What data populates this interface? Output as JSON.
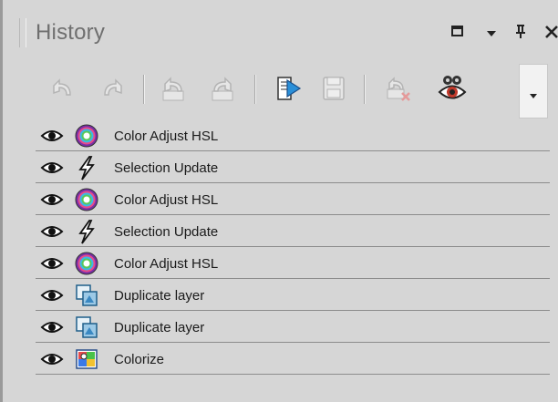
{
  "panel": {
    "title": "History",
    "titlebar_buttons": [
      "maximize-icon",
      "panel-menu-icon",
      "pin-icon",
      "close-icon"
    ]
  },
  "toolbar": {
    "buttons": [
      {
        "icon": "undo-icon",
        "enabled": false
      },
      {
        "icon": "redo-icon",
        "enabled": false
      },
      {
        "icon": "undo-selected-icon",
        "enabled": false
      },
      {
        "icon": "redo-selected-icon",
        "enabled": false
      },
      {
        "icon": "run-script-icon",
        "enabled": true
      },
      {
        "icon": "save-script-icon",
        "enabled": false
      },
      {
        "icon": "clear-history-icon",
        "enabled": false
      },
      {
        "icon": "view-toggle-icon",
        "enabled": true
      }
    ],
    "overflow_icon": "chevron-down-icon"
  },
  "history": {
    "items": [
      {
        "label": "Color Adjust HSL",
        "icon": "color-wheel-icon"
      },
      {
        "label": "Selection Update",
        "icon": "lightning-icon"
      },
      {
        "label": "Color Adjust HSL",
        "icon": "color-wheel-icon"
      },
      {
        "label": "Selection Update",
        "icon": "lightning-icon"
      },
      {
        "label": "Color Adjust HSL",
        "icon": "color-wheel-icon"
      },
      {
        "label": "Duplicate layer",
        "icon": "duplicate-layer-icon"
      },
      {
        "label": "Duplicate layer",
        "icon": "duplicate-layer-icon"
      },
      {
        "label": "Colorize",
        "icon": "colorize-icon"
      }
    ]
  }
}
